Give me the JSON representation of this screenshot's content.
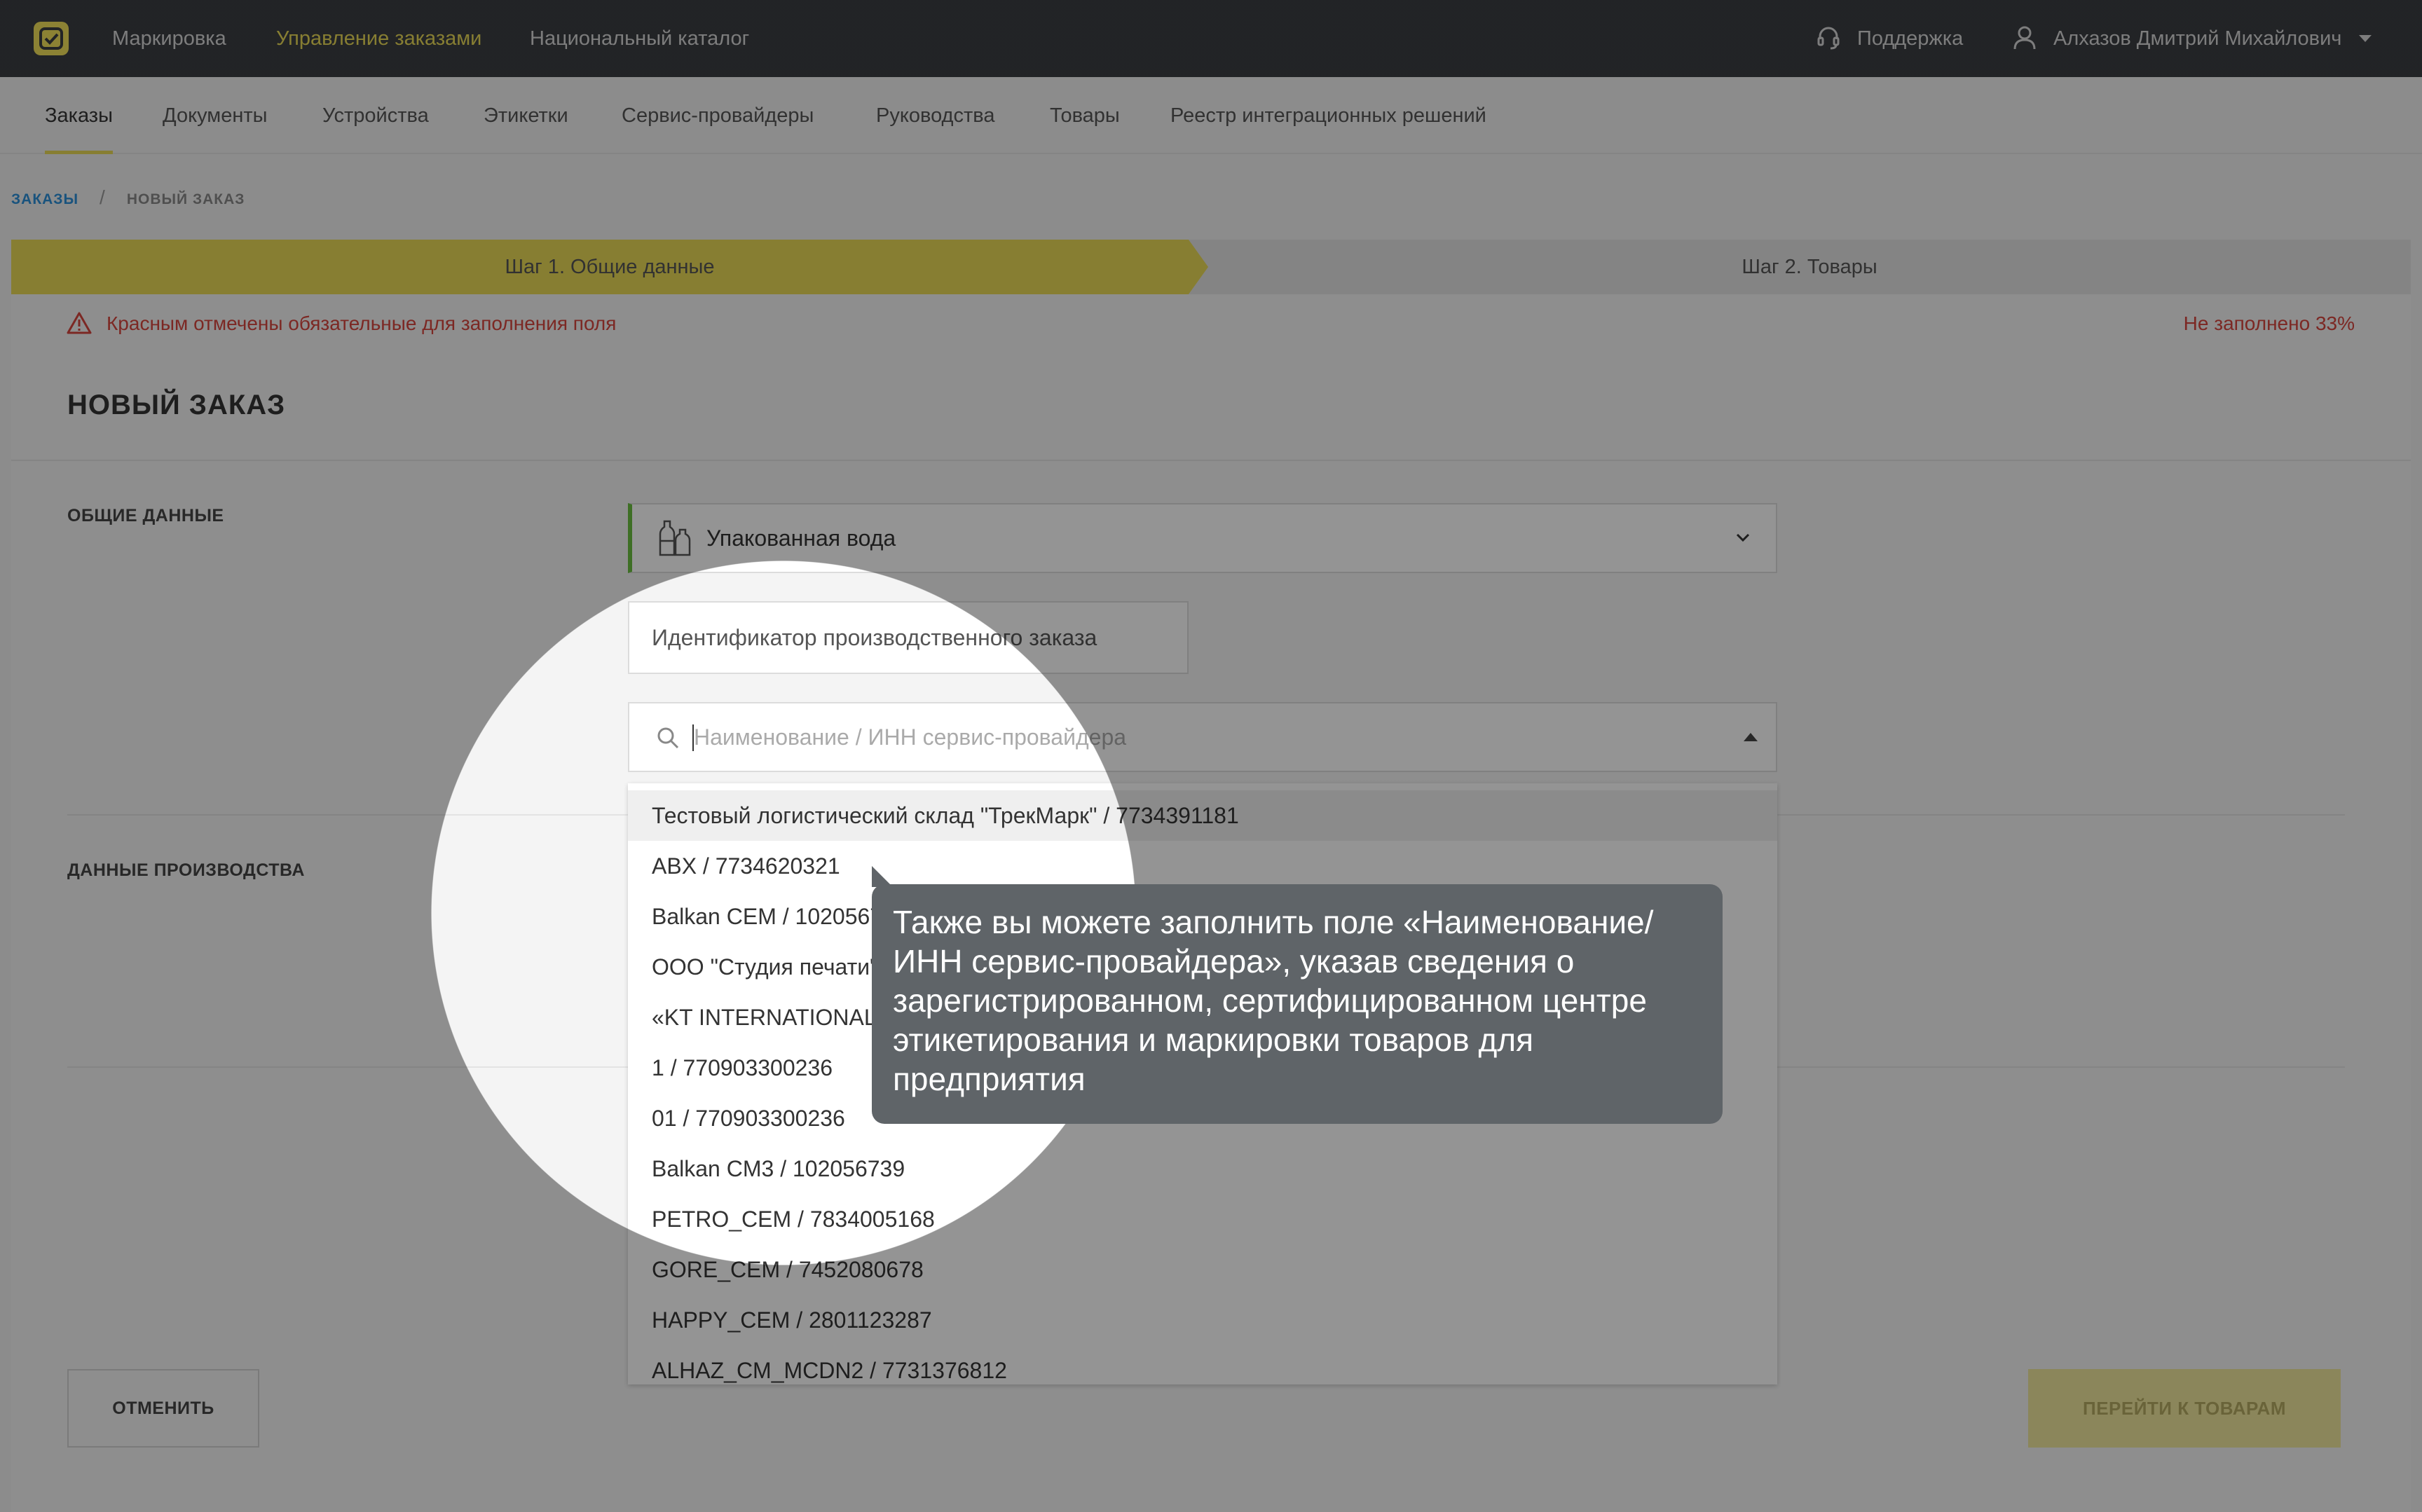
{
  "topbar": {
    "nav": [
      "Маркировка",
      "Управление заказами",
      "Национальный каталог"
    ],
    "support": "Поддержка",
    "user": "Алхазов Дмитрий Михайлович"
  },
  "subnav": [
    "Заказы",
    "Документы",
    "Устройства",
    "Этикетки",
    "Сервис-провайдеры",
    "Руководства",
    "Товары",
    "Реестр интеграционных решений"
  ],
  "breadcrumb": {
    "parent": "ЗАКАЗЫ",
    "separator": "/",
    "current": "НОВЫЙ ЗАКАЗ"
  },
  "steps": {
    "step1": "Шаг 1. Общие данные",
    "step2": "Шаг 2. Товары"
  },
  "notice": {
    "warning": "Красным отмечены обязательные для заполнения поля",
    "status": "Не заполнено 33%"
  },
  "page_title": "НОВЫЙ ЗАКАЗ",
  "sections": {
    "general": "ОБЩИЕ ДАННЫЕ",
    "production": "ДАННЫЕ ПРОИЗВОДСТВА"
  },
  "form": {
    "product_group": "Упакованная вода",
    "order_id_placeholder": "Идентификатор производственного заказа",
    "provider_placeholder": "Наименование / ИНН сервис-провайдера"
  },
  "provider_options": [
    "Тестовый логистический склад \"ТрекМарк\" / 7734391181",
    "ABX / 7734620321",
    "Balkan CEM / 102056739",
    "ООО \"Студия печати\" / 7734620321",
    "«KT INTERNATIONAL» / 7709033002",
    "1 / 770903300236",
    "01 / 770903300236",
    "Balkan CM3 / 102056739",
    "PETRO_CEM / 7834005168",
    "GORE_CEM / 7452080678",
    "HAPPY_CEM / 2801123287",
    "ALHAZ_CM_MCDN2 / 7731376812"
  ],
  "buttons": {
    "cancel": "ОТМЕНИТЬ",
    "next": "ПЕРЕЙТИ К ТОВАРАМ"
  },
  "tooltip": "Также вы можете заполнить поле «Наименование/ИНН сервис-провайдера», указав сведения о зарегистрированном, сертифицированном центре этикетирования и маркировки товаров для предприятия",
  "colors": {
    "accent": "#e8d957",
    "topbar": "#3a3d42",
    "error": "#d6453d",
    "required_ok": "#6bbf3f",
    "link": "#2b8fd8"
  }
}
